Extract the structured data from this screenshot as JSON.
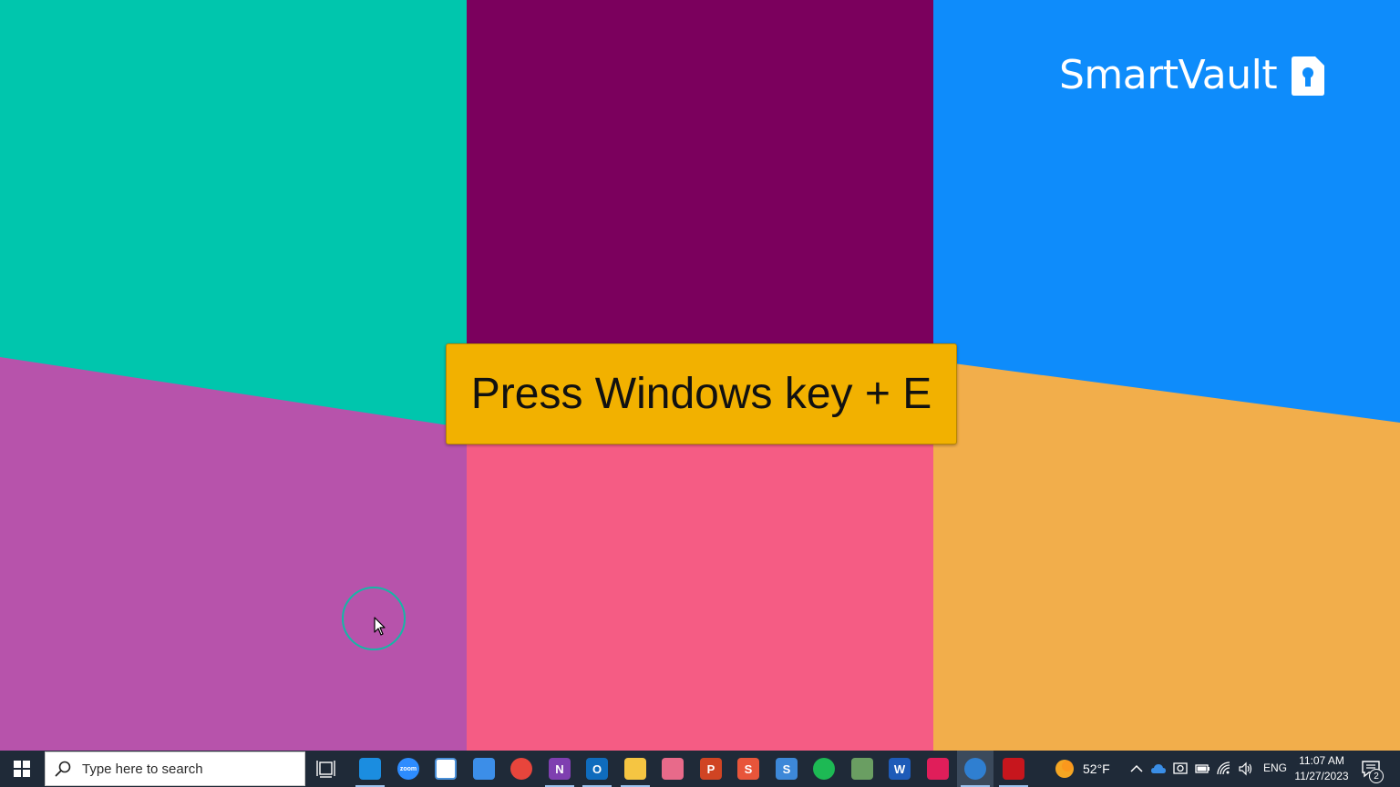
{
  "wallpaper": {
    "colors": {
      "teal": "#00c6ad",
      "plum": "#7b005d",
      "blue": "#0e8cfb",
      "magenta": "#b753ab",
      "pink": "#f55c84",
      "orange": "#f2ae4b"
    }
  },
  "logo": {
    "text": "SmartVault"
  },
  "callout": {
    "text": "Press Windows key + E"
  },
  "taskbar": {
    "search": {
      "placeholder": "Type here to search"
    },
    "apps": [
      {
        "name": "edge",
        "label": "",
        "color": "#1b8de0"
      },
      {
        "name": "zoom",
        "label": "zoom",
        "color": "#2d8cff"
      },
      {
        "name": "microsoft-store",
        "label": "",
        "color": "#ffffff"
      },
      {
        "name": "mail",
        "label": "",
        "color": "#3c8ee8"
      },
      {
        "name": "chrome",
        "label": "",
        "color": "#e8453c"
      },
      {
        "name": "onenote",
        "label": "N",
        "color": "#7f3fb0"
      },
      {
        "name": "outlook",
        "label": "O",
        "color": "#0f6cbd"
      },
      {
        "name": "file-explorer",
        "label": "",
        "color": "#f5c542"
      },
      {
        "name": "photos",
        "label": "",
        "color": "#e86a8a"
      },
      {
        "name": "powerpoint",
        "label": "P",
        "color": "#d04423"
      },
      {
        "name": "snagit",
        "label": "S",
        "color": "#e8553a"
      },
      {
        "name": "smartvault-s",
        "label": "S",
        "color": "#3d88d8"
      },
      {
        "name": "spotify",
        "label": "",
        "color": "#1db954"
      },
      {
        "name": "notepad-app",
        "label": "",
        "color": "#6a9e62"
      },
      {
        "name": "word",
        "label": "W",
        "color": "#1e5bb8"
      },
      {
        "name": "slack",
        "label": "",
        "color": "#e01e5a"
      },
      {
        "name": "screen-recorder",
        "label": "",
        "color": "#2f7fd1"
      },
      {
        "name": "acrobat",
        "label": "",
        "color": "#c7161d"
      }
    ],
    "active_app": "screen-recorder",
    "weather": {
      "temp": "52°F"
    },
    "tray": {
      "language": "ENG",
      "time": "11:07 AM",
      "date": "11/27/2023",
      "notifications": "2"
    }
  }
}
